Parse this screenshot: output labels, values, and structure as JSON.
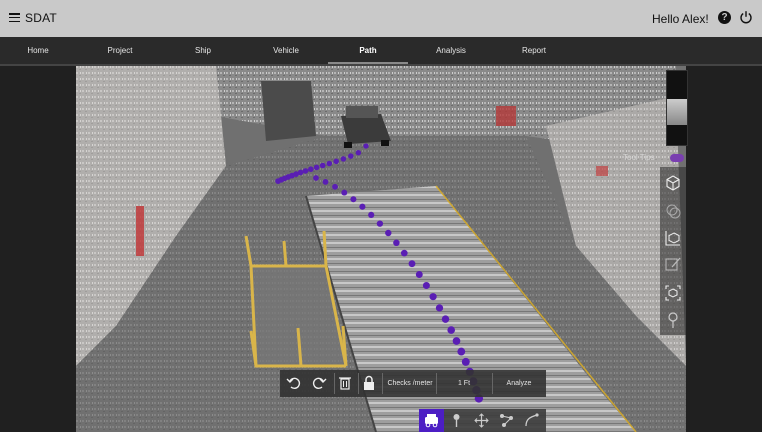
{
  "app": {
    "title": "SDAT",
    "greeting": "Hello Alex!"
  },
  "nav": {
    "tabs": [
      {
        "label": "Home"
      },
      {
        "label": "Project"
      },
      {
        "label": "Ship"
      },
      {
        "label": "Vehicle"
      },
      {
        "label": "Path",
        "active": true
      },
      {
        "label": "Analysis"
      },
      {
        "label": "Report"
      }
    ]
  },
  "viewer": {
    "minimap_label": "Tool Tips",
    "right_tools": [
      "cube-icon",
      "layers-cube-icon",
      "chart-cube-icon",
      "annotate-icon",
      "scan-cube-icon",
      "location-pin-icon"
    ],
    "path_color": "#5a1eb4"
  },
  "toolbar": {
    "undo": "undo-icon",
    "redo": "redo-icon",
    "delete": "trash-icon",
    "lock": "lock-icon",
    "checks_label": "Checks /meter",
    "step_value": "1 Ft",
    "analyze_label": "Analyze"
  },
  "modes": {
    "items": [
      "vehicle-icon",
      "pin-icon",
      "move-icon",
      "waypoints-icon",
      "curve-icon"
    ],
    "active": "vehicle-icon",
    "active_color": "#4c1ec4"
  }
}
